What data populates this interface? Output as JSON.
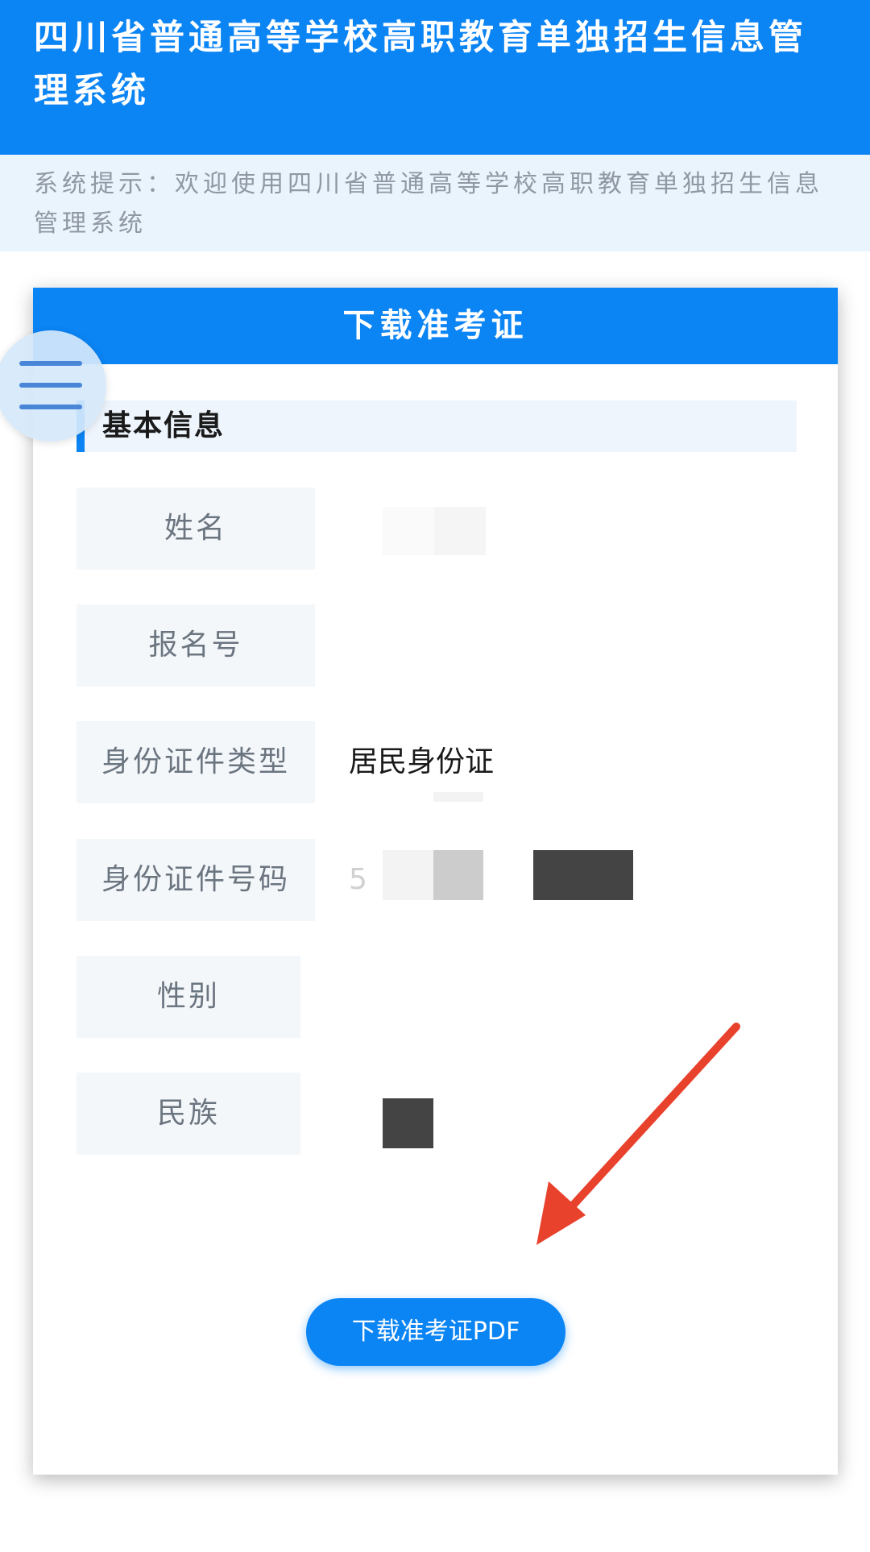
{
  "header": {
    "title": "四川省普通高等学校高职教育单独招生信息管理系统"
  },
  "notice": {
    "text": "系统提示：欢迎使用四川省普通高等学校高职教育单独招生信息管理系统"
  },
  "card": {
    "title": "下载准考证",
    "section_title": "基本信息",
    "fields": [
      {
        "label": "姓名",
        "value": ""
      },
      {
        "label": "报名号",
        "value": ""
      },
      {
        "label": "身份证件类型",
        "value": "居民身份证"
      },
      {
        "label": "身份证件号码",
        "value": "5"
      },
      {
        "label": "性别",
        "value": ""
      },
      {
        "label": "民族",
        "value": ""
      }
    ],
    "download_button": "下载准考证PDF"
  },
  "icons": {
    "menu": "hamburger-menu-icon",
    "arrow": "red-arrow-annotation"
  },
  "colors": {
    "primary": "#0b84f4",
    "notice_bg": "#eaf4fd",
    "annotation": "#e8412c"
  }
}
